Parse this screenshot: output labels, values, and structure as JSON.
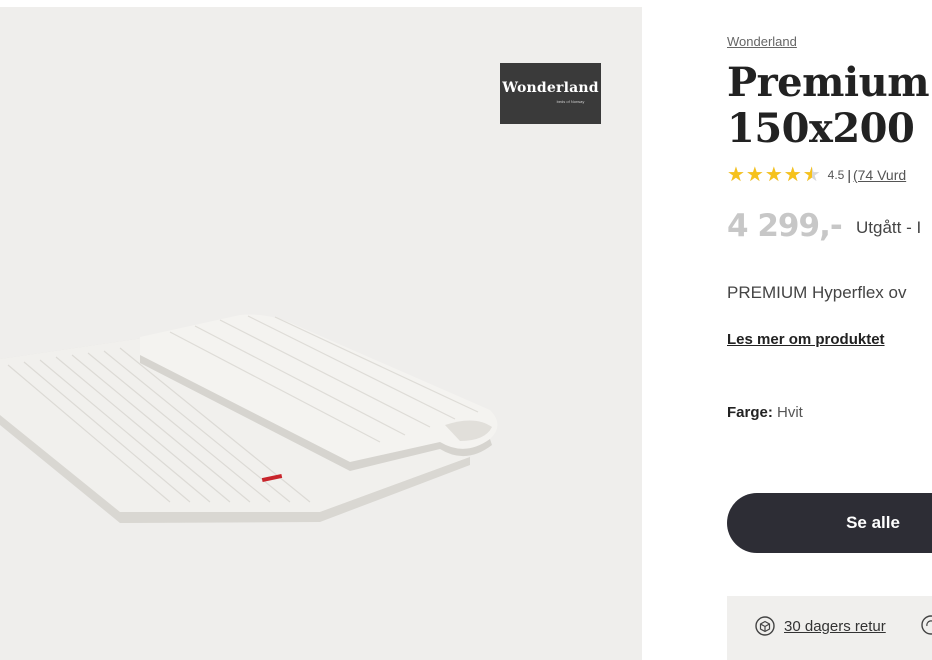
{
  "gallery": {
    "brand_badge": {
      "name": "Wonderland",
      "tagline": "beds of Norway"
    }
  },
  "product": {
    "brand": "Wonderland",
    "title_line1": "Premium H",
    "title_line2": "150x200",
    "rating": {
      "score": "4.5",
      "fraction": 0.9,
      "separator": "|",
      "count_text": "(74 Vurd"
    },
    "price": "4 299,-",
    "stock": "Utgått - I",
    "description": "PREMIUM Hyperflex ov",
    "read_more": "Les mer om produktet",
    "color": {
      "label": "Farge:",
      "value": "Hvit"
    },
    "cta_label": "Se alle",
    "usps": [
      {
        "icon": "return-box-icon",
        "label": "30 dagers retur"
      },
      {
        "icon": "recycle-icon",
        "label": ""
      }
    ]
  },
  "colors": {
    "star": "#f6c21c",
    "cta": "#2d2d35",
    "price": "#c7c7c7",
    "gallery_bg": "#efeeec"
  }
}
